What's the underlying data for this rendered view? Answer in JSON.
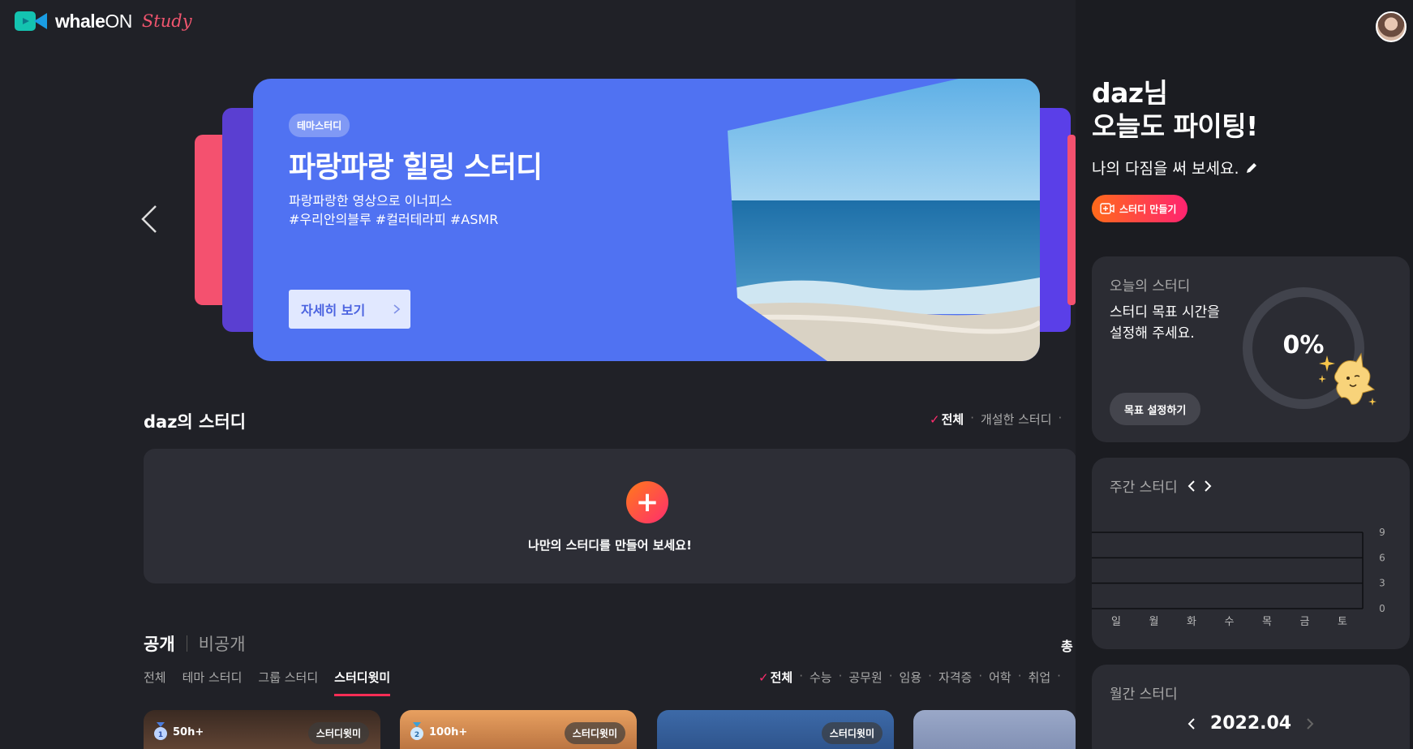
{
  "header": {
    "logo_whale": "whale",
    "logo_on": "ON",
    "logo_study": "Study"
  },
  "hero": {
    "badge": "테마스터디",
    "title": "파랑파랑 힐링 스터디",
    "desc_line1": "파랑파랑한 영상으로 이너피스",
    "desc_line2": "#우리안의블루 #컬러테라피 #ASMR",
    "button": "자세히 보기"
  },
  "my_study": {
    "title": "daz의 스터디",
    "filters": [
      "전체",
      "개설한 스터디"
    ],
    "empty_text": "나만의 스터디를 만들어 보세요!"
  },
  "public": {
    "tab_public": "공개",
    "tab_private": "비공개",
    "total": "총",
    "type_tabs": [
      "전체",
      "테마 스터디",
      "그룹 스터디",
      "스터디윗미"
    ],
    "categories": [
      "전체",
      "수능",
      "공무원",
      "임용",
      "자격증",
      "어학",
      "취업"
    ],
    "cards": [
      {
        "hours": "50h+",
        "tag": "스터디윗미",
        "medal": "1"
      },
      {
        "hours": "100h+",
        "tag": "스터디윗미",
        "medal": "2"
      },
      {
        "hours": "",
        "tag": "스터디윗미",
        "medal": ""
      },
      {
        "hours": "",
        "tag": "",
        "medal": ""
      }
    ]
  },
  "panel": {
    "greet_line1": "daz님",
    "greet_line2": "오늘도 파이팅!",
    "resolve": "나의 다짐을 써 보세요.",
    "create_button": "스터디 만들기",
    "today": {
      "label": "오늘의 스터디",
      "text_line1": "스터디 목표 시간을",
      "text_line2": "설정해 주세요.",
      "goal_button": "목표 설정하기",
      "percent": "0%"
    },
    "weekly": {
      "label": "주간 스터디"
    },
    "monthly": {
      "label": "월간 스터디",
      "month": "2022.04"
    }
  },
  "chart_data": {
    "type": "bar",
    "categories": [
      "일",
      "월",
      "화",
      "수",
      "목",
      "금",
      "토"
    ],
    "values": [
      0,
      0,
      0,
      0,
      0,
      0,
      0
    ],
    "yticks": [
      "9",
      "6",
      "3",
      "0"
    ],
    "ylim": [
      0,
      9
    ],
    "grid": true
  },
  "colors": {
    "accent": "#ff2d6e",
    "hero_bg": "#5072f2",
    "panel_bg": "#1b1c21"
  }
}
